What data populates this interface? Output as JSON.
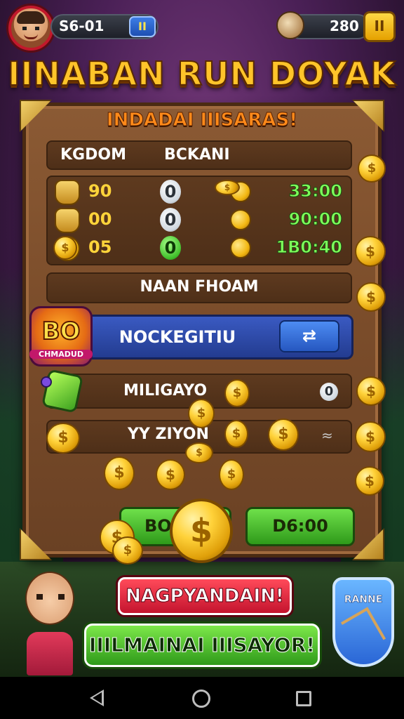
{
  "hud": {
    "score": "S6-01",
    "pause_left": "II",
    "coins": "280",
    "pause_right": "II"
  },
  "title": "IINABAN RUN DOYAK",
  "board": {
    "title": "INDADAI IIISARAS!",
    "header": {
      "left": "KGDOM",
      "right": "BCKANI"
    },
    "rows": [
      {
        "col1": "90",
        "col2": "0",
        "col3": "33:00"
      },
      {
        "col1": "00",
        "col2": "0",
        "col3": "90:00"
      },
      {
        "col1": "05",
        "col2": "0",
        "col3": "1B0:40"
      }
    ],
    "plank_c": "NAAN FHOAM",
    "bonus": {
      "big": "BO",
      "small": "CHMADUD"
    },
    "blue_bar": {
      "label": "NOCKEGITIU",
      "button": "⇄"
    },
    "plank_e": {
      "label": "MILIGAYO",
      "value": "0"
    },
    "plank_f": {
      "label": "YY ZIYON",
      "mark": "≈"
    },
    "btn_left": "BO",
    "btn_right": "D6:00"
  },
  "coin_symbol": "$",
  "bottom": {
    "red_banner": "NAGPYANDAIN!",
    "green_banner": "IIILMAINAI IIISAYOR!",
    "shield_label": "RANNE"
  },
  "colors": {
    "title_gold": "#ffc42a",
    "board_wood": "#7a4c2a",
    "stat_green": "#7dff5a",
    "stat_gold": "#ffd43a",
    "blue_bar": "#3a5ac2",
    "btn_green": "#2f9a1a",
    "banner_red": "#c4142e"
  }
}
